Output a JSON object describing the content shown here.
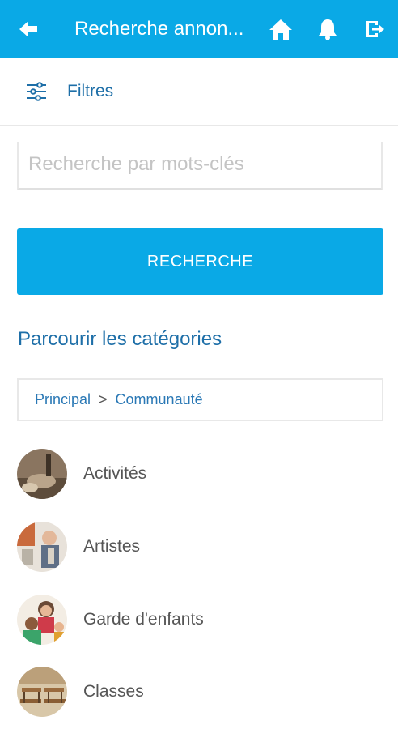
{
  "header": {
    "title": "Recherche annon...",
    "back_icon": "back-arrow-icon",
    "actions": [
      "home-icon",
      "bell-icon",
      "logout-icon"
    ],
    "color": "#0aa9e6"
  },
  "filters": {
    "label": "Filtres",
    "icon": "sliders-icon"
  },
  "search": {
    "placeholder": "Recherche par mots-clés",
    "value": ""
  },
  "search_button": {
    "label": "RECHERCHE"
  },
  "categories_section": {
    "title": "Parcourir les catégories"
  },
  "breadcrumb": {
    "items": [
      "Principal",
      "Communauté"
    ],
    "separator": ">"
  },
  "categories": [
    {
      "label": "Activités"
    },
    {
      "label": "Artistes"
    },
    {
      "label": "Garde d'enfants"
    },
    {
      "label": "Classes"
    }
  ]
}
